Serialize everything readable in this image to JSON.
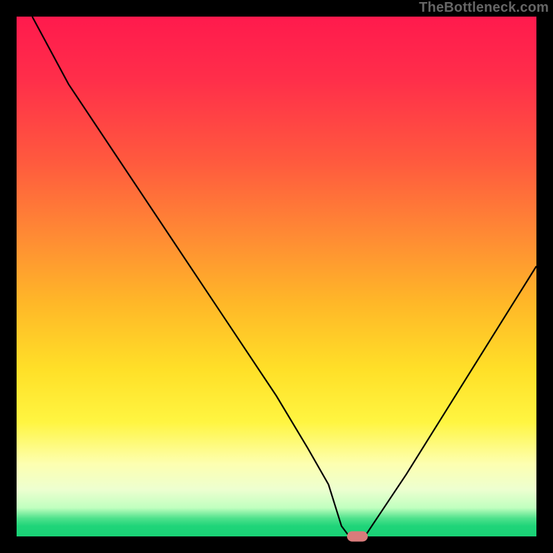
{
  "attribution": "TheBottleneck.com",
  "chart_data": {
    "type": "line",
    "title": "",
    "xlabel": "",
    "ylabel": "",
    "xlim": [
      0,
      100
    ],
    "ylim": [
      0,
      100
    ],
    "series": [
      {
        "name": "bottleneck-curve",
        "x": [
          3,
          10,
          20,
          30,
          40,
          50,
          56,
          60,
          62.5,
          64,
          67,
          75,
          85,
          95,
          100
        ],
        "values": [
          100,
          87,
          72,
          57,
          42,
          27,
          17,
          10,
          2,
          0,
          0,
          12,
          28,
          44,
          52
        ]
      }
    ],
    "marker": {
      "x": 65.5,
      "y": 0,
      "label": "optimal-point"
    },
    "background_type": "gradient-red-yellow-green"
  }
}
